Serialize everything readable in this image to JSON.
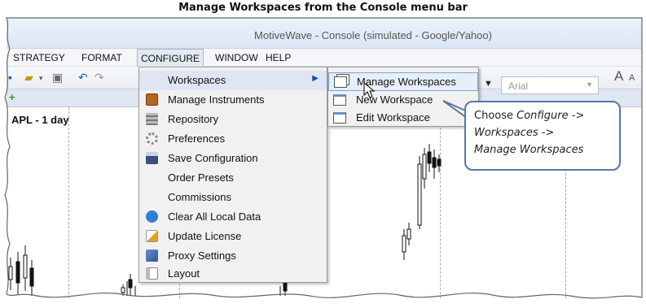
{
  "caption": "Manage Workspaces from the Console menu bar",
  "window": {
    "title": "MotiveWave - Console (simulated - Google/Yahoo)"
  },
  "menubar": [
    "STRATEGY",
    "FORMAT",
    "CONFIGURE",
    "WINDOW",
    "HELP"
  ],
  "active_menu": "CONFIGURE",
  "chart": {
    "label": "APL - 1 day"
  },
  "font_selector": {
    "value": "Arial"
  },
  "configure_menu": [
    {
      "label": "Workspaces",
      "icon": "none",
      "has_submenu": true
    },
    {
      "label": "Manage Instruments",
      "icon": "briefcase-icon"
    },
    {
      "label": "Repository",
      "icon": "cabinet-icon"
    },
    {
      "label": "Preferences",
      "icon": "gear-icon"
    },
    {
      "label": "Save Configuration",
      "icon": "floppy-icon"
    },
    {
      "label": "Order Presets",
      "icon": "none"
    },
    {
      "label": "Commissions",
      "icon": "none"
    },
    {
      "label": "Clear All Local Data",
      "icon": "refresh-icon"
    },
    {
      "label": "Update License",
      "icon": "pencil-icon"
    },
    {
      "label": "Proxy Settings",
      "icon": "network-icon"
    },
    {
      "label": "Layout",
      "icon": "layout-icon"
    }
  ],
  "workspaces_submenu": [
    {
      "label": "Manage Workspaces",
      "icon": "windows-icon"
    },
    {
      "label": "New Workspace",
      "icon": "new-window-icon"
    },
    {
      "label": "Edit Workspace",
      "icon": "edit-window-icon"
    }
  ],
  "callout": {
    "line1": "Choose ",
    "line1_italic": "Configure ->",
    "line2": "Workspaces ->",
    "line3": "Manage Workspaces"
  },
  "colors": {
    "accent": "#1a4fb0",
    "callout_border": "#5577a8",
    "highlight": "#dfe6f3"
  }
}
